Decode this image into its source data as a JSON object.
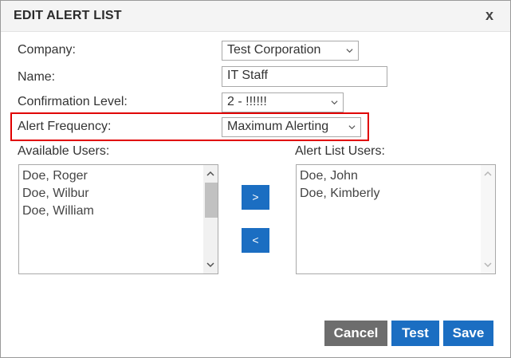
{
  "dialog": {
    "title": "EDIT ALERT LIST",
    "close_label": "x"
  },
  "form": {
    "company_label": "Company:",
    "company_value": "Test Corporation",
    "name_label": "Name:",
    "name_value": "IT Staff",
    "confirmation_label": "Confirmation Level:",
    "confirmation_value": "2 - !!!!!!",
    "frequency_label": "Alert Frequency:",
    "frequency_value": "Maximum Alerting"
  },
  "available_users": {
    "label": "Available Users:",
    "items": [
      "Doe, Roger",
      "Doe, Wilbur",
      "Doe, William"
    ]
  },
  "alert_list_users": {
    "label": "Alert List Users:",
    "items": [
      "Doe, John",
      "Doe, Kimberly"
    ]
  },
  "move": {
    "add_label": ">",
    "remove_label": "<"
  },
  "buttons": {
    "cancel": "Cancel",
    "test": "Test",
    "save": "Save"
  },
  "colors": {
    "primary": "#1b6ec2",
    "cancel": "#6d6d6d",
    "highlight": "#e00000"
  },
  "icons": {
    "dropdown": "chevron-down-icon",
    "scroll_up": "chevron-up-icon",
    "scroll_down": "chevron-down-icon"
  }
}
